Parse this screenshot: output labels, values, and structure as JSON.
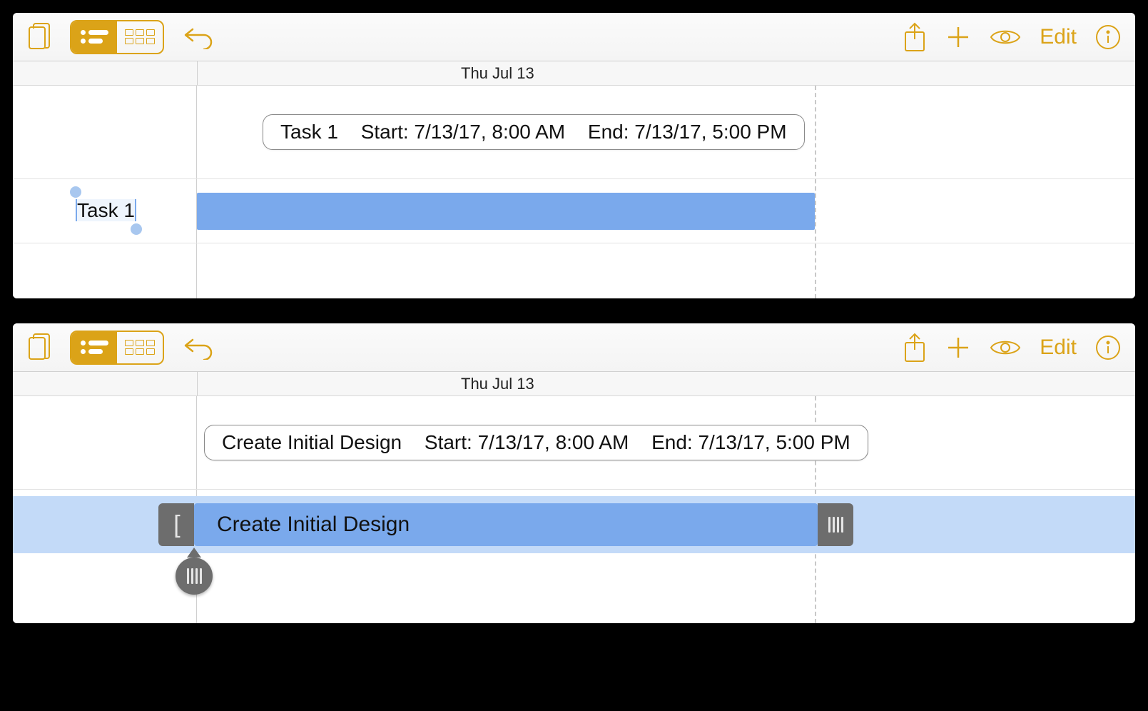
{
  "accent_color": "#dba318",
  "toolbar": {
    "documents_icon": "documents",
    "view_gantt": "gantt",
    "view_cards": "cards",
    "undo_icon": "undo",
    "share_icon": "share",
    "add_icon": "add",
    "eye_icon": "view-options",
    "edit_label": "Edit",
    "info_icon": "info"
  },
  "panel1": {
    "date_header": "Thu Jul 13",
    "popover": {
      "task_name": "Task 1",
      "start_label": "Start: 7/13/17, 8:00 AM",
      "end_label": "End: 7/13/17, 5:00 PM"
    },
    "sidebar_task_label": "Task 1"
  },
  "panel2": {
    "date_header": "Thu Jul 13",
    "popover": {
      "task_name": "Create Initial Design",
      "start_label": "Start: 7/13/17, 8:00 AM",
      "end_label": "End: 7/13/17, 5:00 PM"
    },
    "bar_label": "Create Initial Design",
    "left_handle_glyph": "["
  }
}
